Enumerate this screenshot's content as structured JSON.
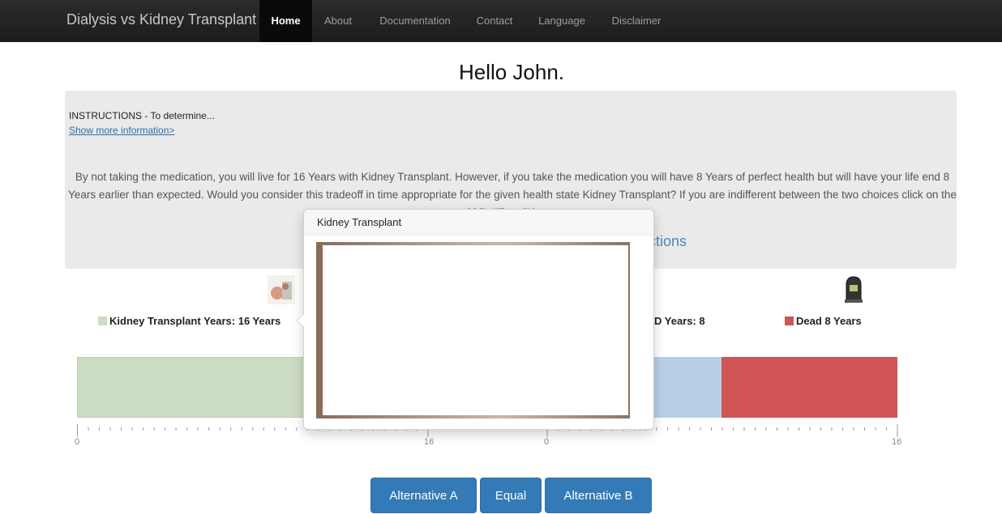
{
  "nav": {
    "brand": "Dialysis vs Kidney Transplant",
    "items": [
      "Home",
      "About",
      "Documentation",
      "Contact",
      "Language",
      "Disclaimer"
    ],
    "active": "Home"
  },
  "greeting": "Hello John.",
  "instructions": {
    "title": "INSTRUCTIONS - To determine...",
    "show_more": "Show more information>",
    "question": "By not taking the medication, you will live for 16 Years with Kidney Transplant. However, if you take the medication you will have 8 Years of perfect health but will have your life end 8 Years earlier than expected. Would you consider this tradeoff in time appropriate for the given health state Kidney Transplant? If you are indifferent between the two choices click on the middle \"Equal\" button.",
    "link_fragment": "ctions"
  },
  "legend": {
    "kidney": "Kidney Transplant Years: 16 Years",
    "fullhealth": "D Years: 8",
    "dead": "Dead 8 Years"
  },
  "colors": {
    "kidney": "#ccdcc3",
    "fullhealth": "#b6cfe5",
    "dead": "#cf5453",
    "button": "#337ab7"
  },
  "icons": [
    "kidney-photo-icon",
    "tombstone-icon"
  ],
  "axis": {
    "ticks": [
      "0",
      "16",
      "0",
      "16"
    ]
  },
  "popover": {
    "title": "Kidney Transplant"
  },
  "buttons": {
    "alt_a": "Alternative A",
    "equal": "Equal",
    "alt_b": "Alternative B"
  }
}
